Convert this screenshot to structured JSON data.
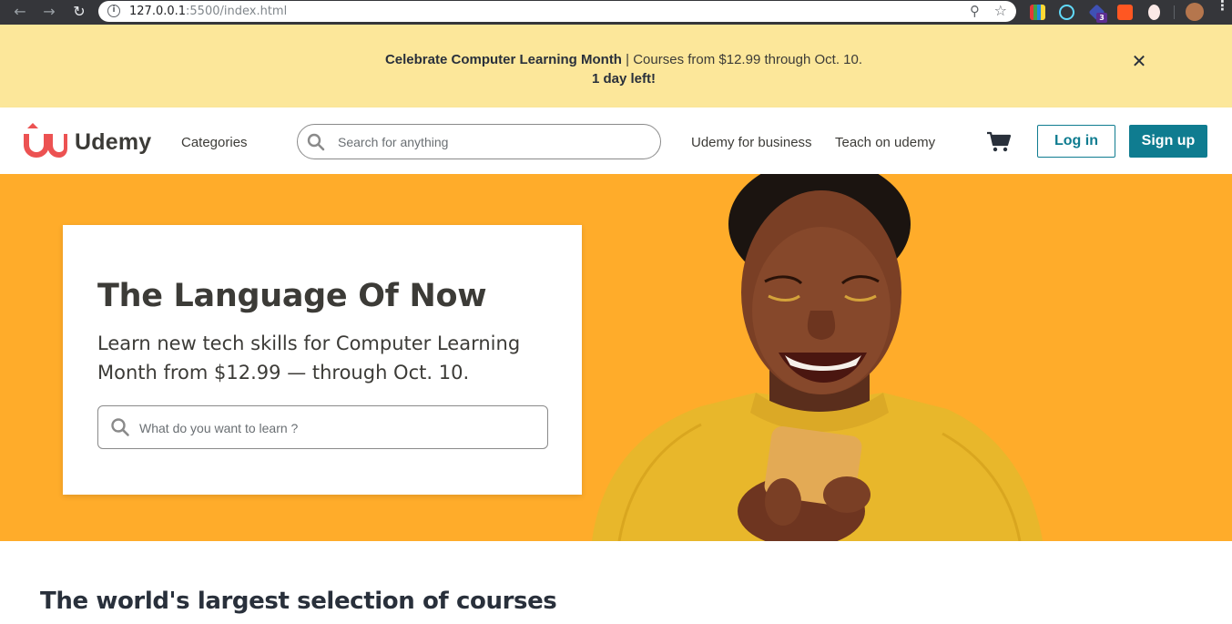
{
  "browser": {
    "url_host": "127.0.0.1",
    "url_rest": ":5500/index.html",
    "back_glyph": "←",
    "forward_glyph": "→",
    "reload_glyph": "↻",
    "info_glyph": "i",
    "zoom_glyph": "⚲",
    "star_glyph": "☆",
    "menu_glyph": "⋮",
    "extension_badge": "3"
  },
  "promo": {
    "strong_text": "Celebrate Computer Learning Month",
    "separator": " | ",
    "detail_text": "Courses from $12.99 through Oct. 10.",
    "countdown": "1 day left!",
    "close_glyph": "✕"
  },
  "header": {
    "logo_text": "Udemy",
    "categories": "Categories",
    "search_placeholder": "Search for anything",
    "business_link": "Udemy for business",
    "teach_link": "Teach on udemy",
    "login_label": "Log in",
    "signup_label": "Sign up"
  },
  "hero": {
    "title": "The Language Of Now",
    "subtitle": "Learn new tech skills for Computer Learning Month from $12.99 — through Oct. 10.",
    "search_placeholder": "What do you want to learn ?"
  },
  "section": {
    "title": "The world's largest selection of courses"
  },
  "colors": {
    "promo_bg": "#fce79a",
    "hero_bg": "#ffac2a",
    "brand_teal": "#0f7c90",
    "logo_red": "#ec5252",
    "text_dark": "#3c3b37"
  },
  "icons": {
    "logo": "udemy-logo-icon",
    "search": "search-icon",
    "cart": "shopping-cart-icon",
    "close": "close-icon"
  }
}
